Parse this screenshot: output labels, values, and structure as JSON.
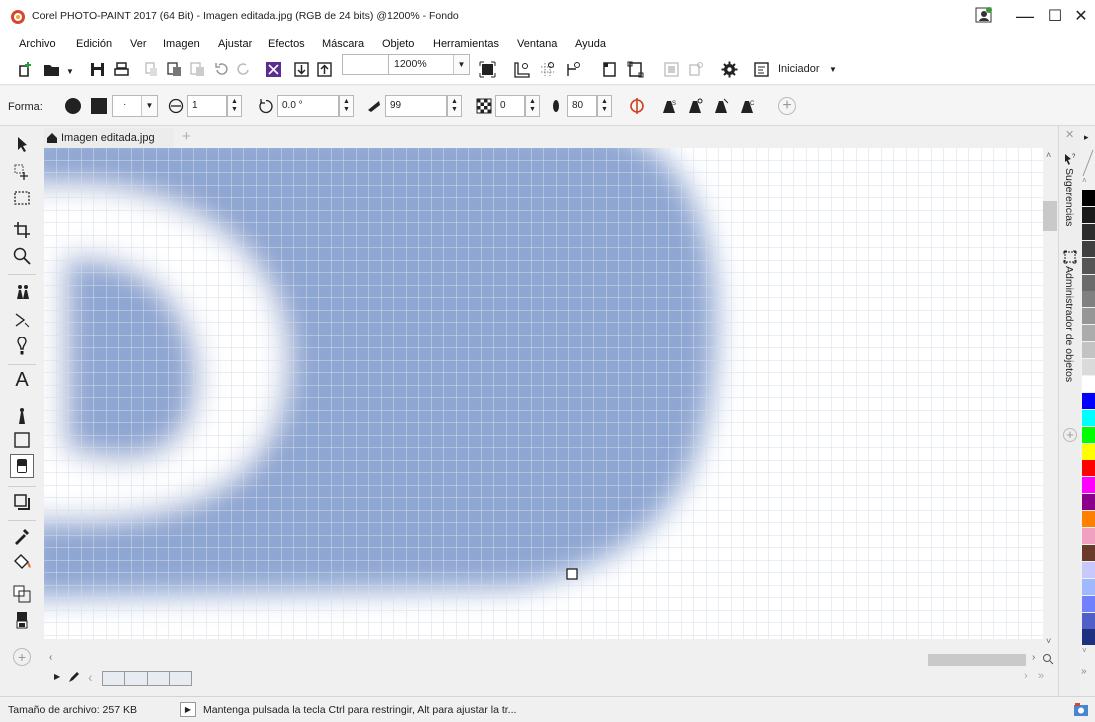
{
  "window": {
    "title": "Corel PHOTO-PAINT 2017 (64 Bit) - Imagen editada.jpg (RGB de 24 bits) @1200% - Fondo",
    "minimize_glyph": "—",
    "maximize_glyph": "☐",
    "close_glyph": "✕"
  },
  "menu": [
    "Archivo",
    "Edición",
    "Ver",
    "Imagen",
    "Ajustar",
    "Efectos",
    "Máscara",
    "Objeto",
    "Herramientas",
    "Ventana",
    "Ayuda"
  ],
  "toolbar": {
    "zoom_value": "1200%",
    "launcher_label": "Iniciador",
    "icons": [
      "new-icon",
      "open-icon",
      "save-icon",
      "print-icon",
      "copy-disabled-icon",
      "paste-icon",
      "paste-disabled-icon",
      "undo-icon",
      "redo-icon",
      "corel-connect-icon",
      "import-icon",
      "export-icon",
      "zoom-fit-icon",
      "show-rulers-icon",
      "show-grid-icon",
      "show-guides-icon",
      "mask-icon",
      "mask-marquee-icon",
      "object-marquee-icon",
      "lens-icon",
      "options-icon",
      "launcher-icon"
    ]
  },
  "property_bar": {
    "shape_label": "Forma:",
    "size_value": "1",
    "rotate_value": "0.0 °",
    "flatten_value": "99",
    "transparency_value": "0",
    "soft_edge_value": "80",
    "add_glyph": "+"
  },
  "document": {
    "tab_name": "Imagen editada.jpg",
    "add_tab_glyph": "+"
  },
  "dockers": {
    "hints": "Sugerencias",
    "objects": "Administrador de objetos",
    "close_glyph": "✕",
    "add_glyph": "+"
  },
  "palette": [
    "#000000",
    "#1a1a1a",
    "#2d2d2d",
    "#404040",
    "#555555",
    "#6b6b6b",
    "#808080",
    "#969696",
    "#acacac",
    "#c3c3c3",
    "#dadada",
    "#ffffff",
    "#0000ff",
    "#00ffff",
    "#00ff00",
    "#ffff00",
    "#ff0000",
    "#ff00ff",
    "#8b008b",
    "#ff7f00",
    "#f0a0c0",
    "#6b3a2a",
    "#c8c8ff",
    "#a0b8ff",
    "#7080ff",
    "#5060c8",
    "#203080"
  ],
  "image_colors": {
    "blue": "#8ea6d2",
    "light_blue": "#b3c5e6",
    "white": "#ffffff"
  },
  "status": {
    "file_size": "Tamaño de archivo: 257 KB",
    "hint": "Mantenga pulsada la tecla Ctrl para restringir, Alt para ajustar la tr..."
  }
}
